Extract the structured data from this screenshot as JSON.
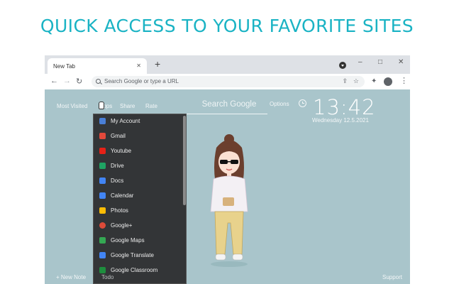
{
  "headline": "QUICK ACCESS TO YOUR FAVORITE SITES",
  "browser": {
    "tab_title": "New Tab",
    "new_tab_glyph": "+",
    "window_controls": [
      "–",
      "□",
      "✕"
    ],
    "omnibox_placeholder": "Search Google or type a URL",
    "icons": [
      "back-icon",
      "forward-icon",
      "reload-icon",
      "search-icon",
      "share-icon",
      "star-icon",
      "extensions-icon",
      "profile-icon",
      "more-icon"
    ]
  },
  "page": {
    "topnav": [
      "Most Visited",
      "Apps",
      "Share",
      "Rate"
    ],
    "search_label": "Search Google",
    "options_label": "Options",
    "time": "13:42",
    "date": "Wednesday  12.5.2021",
    "apps": [
      {
        "label": "My Account",
        "color": "#4a7fd6"
      },
      {
        "label": "Gmail",
        "color": "#e2493b"
      },
      {
        "label": "Youtube",
        "color": "#e62117"
      },
      {
        "label": "Drive",
        "color": "#1fa463"
      },
      {
        "label": "Docs",
        "color": "#4285f4"
      },
      {
        "label": "Calendar",
        "color": "#4285f4"
      },
      {
        "label": "Photos",
        "color": "#fbbc05"
      },
      {
        "label": "Google+",
        "color": "#dd4b39"
      },
      {
        "label": "Google Maps",
        "color": "#34a853"
      },
      {
        "label": "Google Translate",
        "color": "#4285f4"
      },
      {
        "label": "Google Classroom",
        "color": "#1e8e3e"
      }
    ],
    "bottom_left": "+ New Note",
    "bottom_mid": "Todo",
    "bottom_right": "Support"
  }
}
